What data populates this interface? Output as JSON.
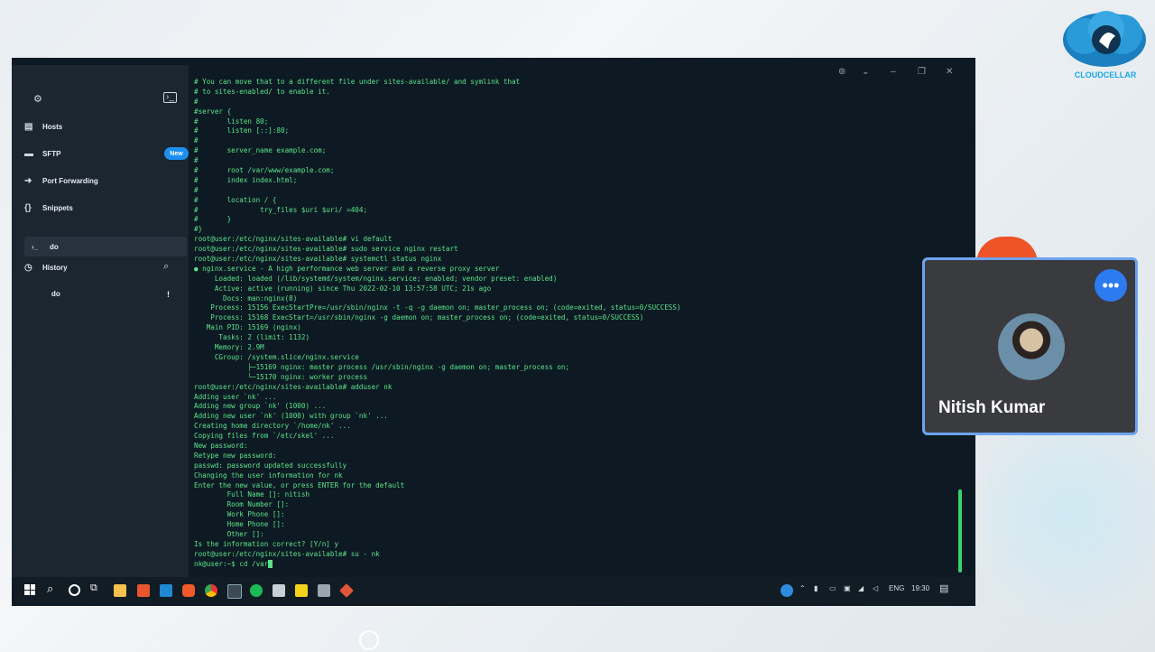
{
  "brand": {
    "logo_text": "CLOUDCELLAR"
  },
  "sidebar": {
    "items": [
      {
        "label": "Hosts",
        "icon": "hosts-icon"
      },
      {
        "label": "SFTP",
        "icon": "folder-icon",
        "badge": "New"
      },
      {
        "label": "Port Forwarding",
        "icon": "arrow-icon"
      },
      {
        "label": "Snippets",
        "icon": "braces-icon"
      }
    ],
    "session": {
      "label": "do",
      "icon": "terminal-prompt-icon"
    },
    "history": {
      "label": "History",
      "item": "do",
      "item_mark": "!"
    }
  },
  "terminal": {
    "lines": [
      "# You can move that to a different file under sites-available/ and symlink that",
      "# to sites-enabled/ to enable it.",
      "#",
      "#server {",
      "#       listen 80;",
      "#       listen [::]:80;",
      "#",
      "#       server_name example.com;",
      "#",
      "#       root /var/www/example.com;",
      "#       index index.html;",
      "#",
      "#       location / {",
      "#               try_files $uri $uri/ =404;",
      "#       }",
      "#}",
      "root@user:/etc/nginx/sites-available# vi default",
      "root@user:/etc/nginx/sites-available# sudo service nginx restart",
      "root@user:/etc/nginx/sites-available# systemctl status nginx",
      "● nginx.service - A high performance web server and a reverse proxy server",
      "     Loaded: loaded (/lib/systemd/system/nginx.service; enabled; vendor preset: enabled)",
      "     Active: active (running) since Thu 2022-02-10 13:57:58 UTC; 21s ago",
      "       Docs: man:nginx(8)",
      "    Process: 15156 ExecStartPre=/usr/sbin/nginx -t -q -g daemon on; master_process on; (code=exited, status=0/SUCCESS)",
      "    Process: 15168 ExecStart=/usr/sbin/nginx -g daemon on; master_process on; (code=exited, status=0/SUCCESS)",
      "   Main PID: 15169 (nginx)",
      "      Tasks: 2 (limit: 1132)",
      "     Memory: 2.9M",
      "     CGroup: /system.slice/nginx.service",
      "             ├─15169 nginx: master process /usr/sbin/nginx -g daemon on; master_process on;",
      "             └─15170 nginx: worker process",
      "root@user:/etc/nginx/sites-available# adduser nk",
      "Adding user `nk' ...",
      "Adding new group `nk' (1000) ...",
      "Adding new user `nk' (1000) with group `nk' ...",
      "Creating home directory `/home/nk' ...",
      "Copying files from `/etc/skel' ...",
      "New password:",
      "Retype new password:",
      "passwd: password updated successfully",
      "Changing the user information for nk",
      "Enter the new value, or press ENTER for the default",
      "        Full Name []: nitish",
      "        Room Number []:",
      "        Work Phone []:",
      "        Home Phone []:",
      "        Other []:",
      "Is the information correct? [Y/n] y",
      "root@user:/etc/nginx/sites-available# su - nk"
    ],
    "prompt": "nk@user:~$ cd /var"
  },
  "taskbar": {
    "language": "ENG",
    "time": "19:30"
  },
  "call": {
    "participant_name": "Nitish Kumar",
    "more_icon": "more-horizontal-icon",
    "accent": "#2e7bf0"
  }
}
